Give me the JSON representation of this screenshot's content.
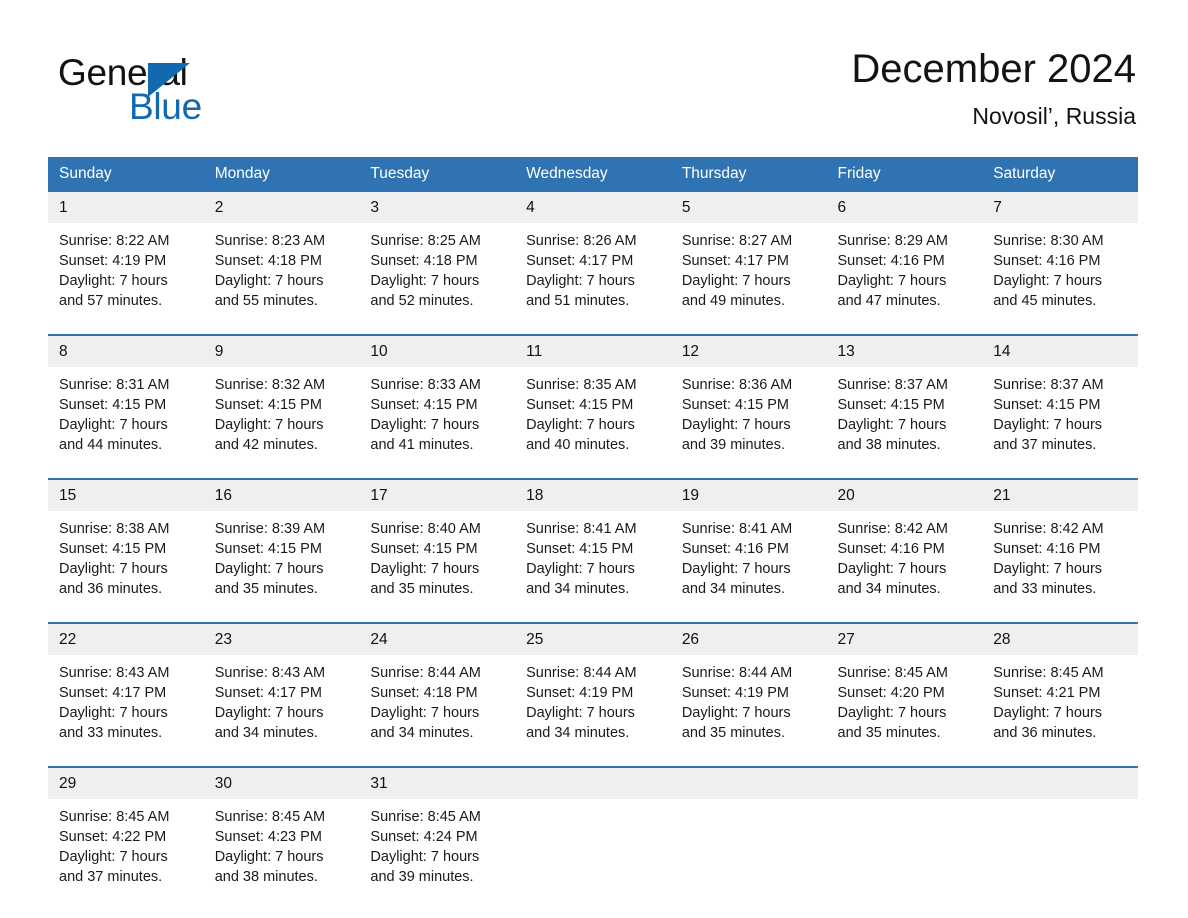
{
  "logo": {
    "word_one": "General",
    "word_two": "Blue",
    "triangle_icon": "blue-triangle-icon",
    "accent_color": "#1269b0"
  },
  "header": {
    "title": "December 2024",
    "subtitle": "Novosil’, Russia"
  },
  "theme": {
    "header_blue": "#2f73b3",
    "row_gray": "#efefef",
    "text": "#1a1a1a"
  },
  "weekdays": [
    "Sunday",
    "Monday",
    "Tuesday",
    "Wednesday",
    "Thursday",
    "Friday",
    "Saturday"
  ],
  "weeks": [
    {
      "days": [
        {
          "num": "1",
          "detail": "Sunrise: 8:22 AM\nSunset: 4:19 PM\nDaylight: 7 hours\nand 57 minutes."
        },
        {
          "num": "2",
          "detail": "Sunrise: 8:23 AM\nSunset: 4:18 PM\nDaylight: 7 hours\nand 55 minutes."
        },
        {
          "num": "3",
          "detail": "Sunrise: 8:25 AM\nSunset: 4:18 PM\nDaylight: 7 hours\nand 52 minutes."
        },
        {
          "num": "4",
          "detail": "Sunrise: 8:26 AM\nSunset: 4:17 PM\nDaylight: 7 hours\nand 51 minutes."
        },
        {
          "num": "5",
          "detail": "Sunrise: 8:27 AM\nSunset: 4:17 PM\nDaylight: 7 hours\nand 49 minutes."
        },
        {
          "num": "6",
          "detail": "Sunrise: 8:29 AM\nSunset: 4:16 PM\nDaylight: 7 hours\nand 47 minutes."
        },
        {
          "num": "7",
          "detail": "Sunrise: 8:30 AM\nSunset: 4:16 PM\nDaylight: 7 hours\nand 45 minutes."
        }
      ]
    },
    {
      "days": [
        {
          "num": "8",
          "detail": "Sunrise: 8:31 AM\nSunset: 4:15 PM\nDaylight: 7 hours\nand 44 minutes."
        },
        {
          "num": "9",
          "detail": "Sunrise: 8:32 AM\nSunset: 4:15 PM\nDaylight: 7 hours\nand 42 minutes."
        },
        {
          "num": "10",
          "detail": "Sunrise: 8:33 AM\nSunset: 4:15 PM\nDaylight: 7 hours\nand 41 minutes."
        },
        {
          "num": "11",
          "detail": "Sunrise: 8:35 AM\nSunset: 4:15 PM\nDaylight: 7 hours\nand 40 minutes."
        },
        {
          "num": "12",
          "detail": "Sunrise: 8:36 AM\nSunset: 4:15 PM\nDaylight: 7 hours\nand 39 minutes."
        },
        {
          "num": "13",
          "detail": "Sunrise: 8:37 AM\nSunset: 4:15 PM\nDaylight: 7 hours\nand 38 minutes."
        },
        {
          "num": "14",
          "detail": "Sunrise: 8:37 AM\nSunset: 4:15 PM\nDaylight: 7 hours\nand 37 minutes."
        }
      ]
    },
    {
      "days": [
        {
          "num": "15",
          "detail": "Sunrise: 8:38 AM\nSunset: 4:15 PM\nDaylight: 7 hours\nand 36 minutes."
        },
        {
          "num": "16",
          "detail": "Sunrise: 8:39 AM\nSunset: 4:15 PM\nDaylight: 7 hours\nand 35 minutes."
        },
        {
          "num": "17",
          "detail": "Sunrise: 8:40 AM\nSunset: 4:15 PM\nDaylight: 7 hours\nand 35 minutes."
        },
        {
          "num": "18",
          "detail": "Sunrise: 8:41 AM\nSunset: 4:15 PM\nDaylight: 7 hours\nand 34 minutes."
        },
        {
          "num": "19",
          "detail": "Sunrise: 8:41 AM\nSunset: 4:16 PM\nDaylight: 7 hours\nand 34 minutes."
        },
        {
          "num": "20",
          "detail": "Sunrise: 8:42 AM\nSunset: 4:16 PM\nDaylight: 7 hours\nand 34 minutes."
        },
        {
          "num": "21",
          "detail": "Sunrise: 8:42 AM\nSunset: 4:16 PM\nDaylight: 7 hours\nand 33 minutes."
        }
      ]
    },
    {
      "days": [
        {
          "num": "22",
          "detail": "Sunrise: 8:43 AM\nSunset: 4:17 PM\nDaylight: 7 hours\nand 33 minutes."
        },
        {
          "num": "23",
          "detail": "Sunrise: 8:43 AM\nSunset: 4:17 PM\nDaylight: 7 hours\nand 34 minutes."
        },
        {
          "num": "24",
          "detail": "Sunrise: 8:44 AM\nSunset: 4:18 PM\nDaylight: 7 hours\nand 34 minutes."
        },
        {
          "num": "25",
          "detail": "Sunrise: 8:44 AM\nSunset: 4:19 PM\nDaylight: 7 hours\nand 34 minutes."
        },
        {
          "num": "26",
          "detail": "Sunrise: 8:44 AM\nSunset: 4:19 PM\nDaylight: 7 hours\nand 35 minutes."
        },
        {
          "num": "27",
          "detail": "Sunrise: 8:45 AM\nSunset: 4:20 PM\nDaylight: 7 hours\nand 35 minutes."
        },
        {
          "num": "28",
          "detail": "Sunrise: 8:45 AM\nSunset: 4:21 PM\nDaylight: 7 hours\nand 36 minutes."
        }
      ]
    },
    {
      "days": [
        {
          "num": "29",
          "detail": "Sunrise: 8:45 AM\nSunset: 4:22 PM\nDaylight: 7 hours\nand 37 minutes."
        },
        {
          "num": "30",
          "detail": "Sunrise: 8:45 AM\nSunset: 4:23 PM\nDaylight: 7 hours\nand 38 minutes."
        },
        {
          "num": "31",
          "detail": "Sunrise: 8:45 AM\nSunset: 4:24 PM\nDaylight: 7 hours\nand 39 minutes."
        },
        {
          "num": "",
          "detail": ""
        },
        {
          "num": "",
          "detail": ""
        },
        {
          "num": "",
          "detail": ""
        },
        {
          "num": "",
          "detail": ""
        }
      ]
    }
  ]
}
